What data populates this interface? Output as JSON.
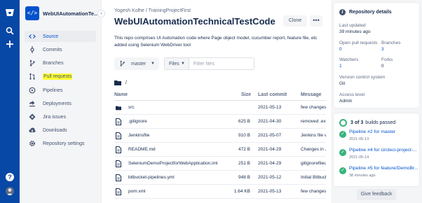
{
  "global_nav": {
    "icons": [
      "bitbucket-logo",
      "search-icon",
      "plus-icon",
      "help-icon",
      "user-avatar"
    ],
    "help_glyph": "?"
  },
  "sidebar": {
    "repo_avatar_glyph": "</>",
    "repo_name": "WebUIAutomationTec...",
    "collapse_glyph": "‹",
    "items": [
      {
        "label": "Source",
        "icon": "code-icon"
      },
      {
        "label": "Commits",
        "icon": "commit-icon"
      },
      {
        "label": "Branches",
        "icon": "branch-icon"
      },
      {
        "label": "Pull requests",
        "icon": "pull-request-icon"
      },
      {
        "label": "Pipelines",
        "icon": "pipelines-icon"
      },
      {
        "label": "Deployments",
        "icon": "deployments-icon"
      },
      {
        "label": "Jira issues",
        "icon": "jira-icon"
      },
      {
        "label": "Downloads",
        "icon": "download-icon"
      },
      {
        "label": "Repository settings",
        "icon": "gear-icon"
      }
    ]
  },
  "main": {
    "breadcrumb": "Yogesh Kolhe  /  TrainingProjectFirst",
    "title": "WebUIAutomationTechnicalTestCode",
    "clone_label": "Clone",
    "more_glyph": "•••",
    "description": "This repo comprises UI Automation code where Page object model, cucumber report, feature file, etc added using Selenium WebDriver tool",
    "branch": "master",
    "files_label": "Files",
    "filter_placeholder": "Filter files",
    "path": "/",
    "columns": [
      "Name",
      "Size",
      "Last commit",
      "Message"
    ],
    "rows": [
      {
        "name": "src",
        "type": "folder",
        "size": "",
        "last_commit": "2021-05-13",
        "message": "few changes i"
      },
      {
        "name": ".gitignore",
        "type": "file",
        "size": "625 B",
        "last_commit": "2021-04-30",
        "message": "removed .exe"
      },
      {
        "name": "Jenkinsfile",
        "type": "file",
        "size": "910 B",
        "last_commit": "2021-05-07",
        "message": "Jenkins file wi"
      },
      {
        "name": "README.md",
        "type": "file",
        "size": "472 B",
        "last_commit": "2021-04-29",
        "message": "Changes in Je"
      },
      {
        "name": "SeleniumDemoProjectforWebApplication.iml",
        "type": "file",
        "size": "251 B",
        "last_commit": "2021-04-29",
        "message": "gitignorefileu"
      },
      {
        "name": "bitbucket-pipelines.yml",
        "type": "file",
        "size": "948 B",
        "last_commit": "2021-05-12",
        "message": "Initial Bitbuck"
      },
      {
        "name": "pom.xml",
        "type": "file",
        "size": "1.64 KB",
        "last_commit": "2021-05-13",
        "message": "few changes i"
      }
    ]
  },
  "details": {
    "title": "Repository details",
    "last_updated_label": "Last updated",
    "last_updated_value": "39 minutes ago",
    "open_prs_label": "Open pull requests",
    "open_prs_value": "0",
    "branches_label": "Branches",
    "branches_value": "3",
    "watchers_label": "Watchers",
    "watchers_value": "1",
    "forks_label": "Forks",
    "forks_value": "0",
    "vcs_label": "Version control system",
    "vcs_value": "Git",
    "access_label": "Access level",
    "access_value": "Admin"
  },
  "builds": {
    "count_bold": "3 of 3",
    "count_rest": "builds passed",
    "items": [
      {
        "name": "Pipeline #2 for master",
        "time": "2021-05-13"
      },
      {
        "name": "Pipeline #4 for circleci-project-...",
        "time": "2021-05-14"
      },
      {
        "name": "Pipeline #5 for feature/DemoBr...",
        "time": "38 minutes ago"
      }
    ]
  },
  "feedback_label": "Give feedback",
  "colors": {
    "nav_blue": "#0747a6",
    "link_blue": "#0052cc",
    "success_green": "#36b37e",
    "highlight_yellow": "#ffff33"
  }
}
